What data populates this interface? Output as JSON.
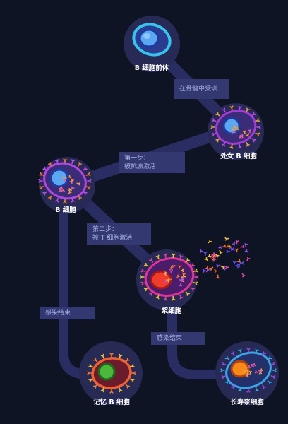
{
  "diagram": {
    "nodes": [
      {
        "id": "pro_b",
        "label": "B 细胞前体"
      },
      {
        "id": "naive_b",
        "label": "处女 B 细胞"
      },
      {
        "id": "b_cell",
        "label": "B 细胞"
      },
      {
        "id": "plasma",
        "label": "浆细胞"
      },
      {
        "id": "memory_b",
        "label": "记忆 B 细胞"
      },
      {
        "id": "long_plasma",
        "label": "长寿浆细胞"
      }
    ],
    "steps": [
      {
        "from": "pro_b",
        "to": "naive_b",
        "lines": [
          "在骨髓中受训"
        ]
      },
      {
        "from": "naive_b",
        "to": "b_cell",
        "lines": [
          "第一步：",
          "被抗原激活"
        ]
      },
      {
        "from": "b_cell",
        "to": "plasma",
        "lines": [
          "第二步：",
          "被 T 细胞激活"
        ]
      },
      {
        "from": "b_cell",
        "to": "memory_b",
        "lines": [
          "感染结束"
        ]
      },
      {
        "from": "plasma",
        "to": "long_plasma",
        "lines": [
          "感染结束"
        ]
      }
    ]
  },
  "colors": {
    "background": "#0f1424",
    "path": "#2a2d62",
    "node_circle": "#262a55",
    "label_box": "#333870",
    "label_text": "#a9b2e8"
  }
}
